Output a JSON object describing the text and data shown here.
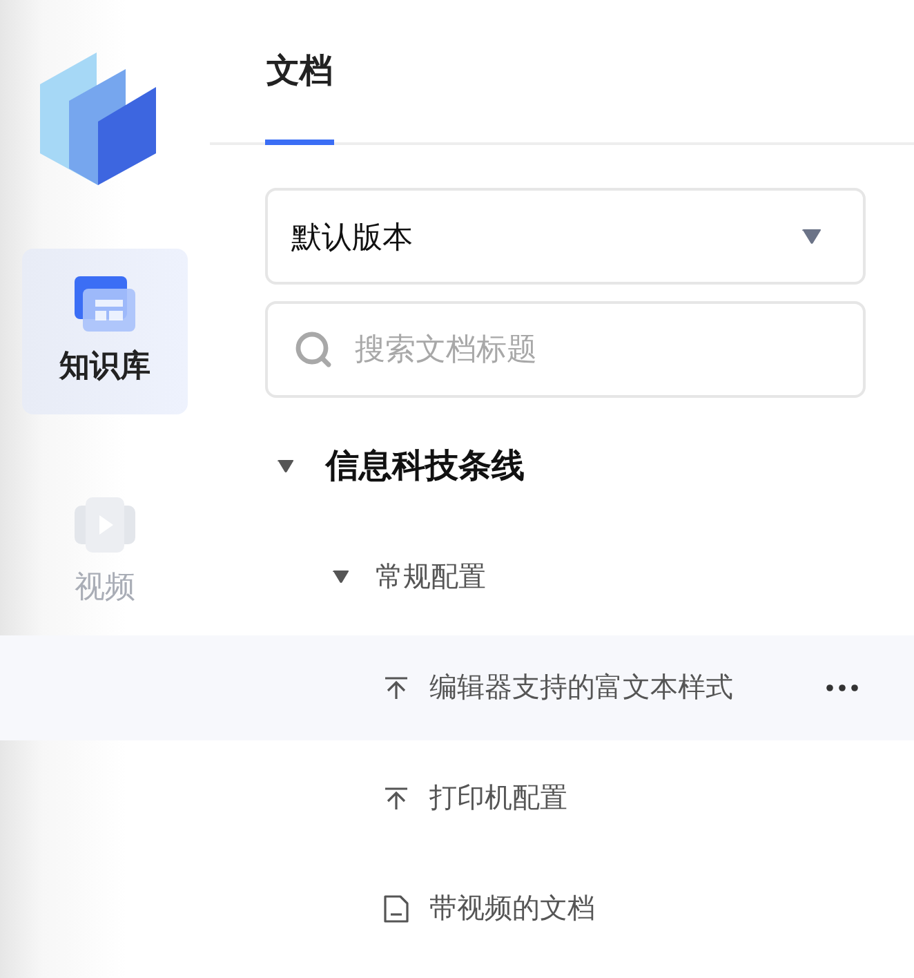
{
  "nav": [
    {
      "kind": "knowledge",
      "label": "知识库",
      "selected": true
    },
    {
      "kind": "video",
      "label": "视频",
      "selected": false
    }
  ],
  "tabs": [
    {
      "label": "文档",
      "selected": true
    }
  ],
  "version_select": {
    "value": "默认版本"
  },
  "search": {
    "placeholder": "搜索文档标题"
  },
  "tree": [
    {
      "kind": "folder",
      "label": "信息科技条线",
      "expanded": true,
      "children": [
        {
          "kind": "folder",
          "label": "常规配置",
          "expanded": true,
          "children": [
            {
              "kind": "pinned",
              "label": "编辑器支持的富文本样式",
              "selected": true
            },
            {
              "kind": "pinned",
              "label": "打印机配置",
              "selected": false
            },
            {
              "kind": "document",
              "label": "带视频的文档",
              "selected": false
            }
          ]
        }
      ]
    }
  ]
}
